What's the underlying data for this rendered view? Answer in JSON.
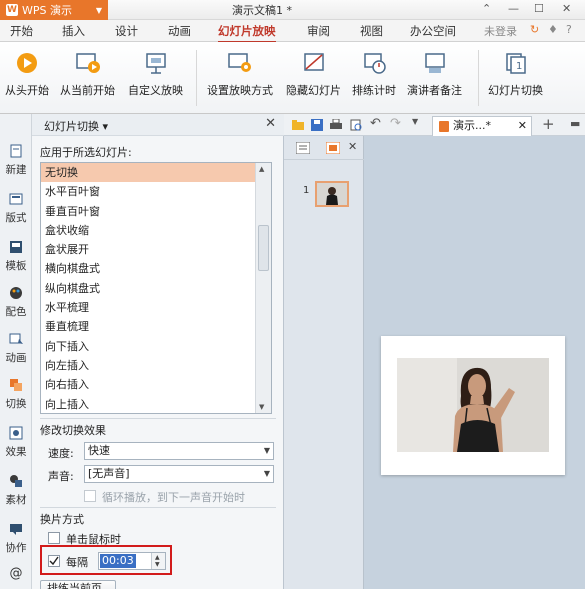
{
  "app": {
    "name": "WPS 演示",
    "document_title": "演示文稿1 *"
  },
  "menu": {
    "items": [
      "开始",
      "插入",
      "设计",
      "动画",
      "幻灯片放映",
      "审阅",
      "视图",
      "办公空间"
    ],
    "active": "幻灯片放映",
    "login": "未登录"
  },
  "toolbar": {
    "buttons": [
      {
        "label": "从头开始",
        "icon": "play-circle-icon"
      },
      {
        "label": "从当前开始",
        "icon": "play-current-icon"
      },
      {
        "label": "自定义放映",
        "icon": "custom-show-icon"
      },
      {
        "label": "设置放映方式",
        "icon": "setup-show-icon"
      },
      {
        "label": "隐藏幻灯片",
        "icon": "hide-slide-icon"
      },
      {
        "label": "排练计时",
        "icon": "rehearse-timing-icon"
      },
      {
        "label": "演讲者备注",
        "icon": "speaker-notes-icon"
      },
      {
        "label": "幻灯片切换",
        "icon": "slide-transition-icon"
      }
    ]
  },
  "sidebar": {
    "items": [
      {
        "label": "新建",
        "icon": "new-doc-icon"
      },
      {
        "label": "版式",
        "icon": "layout-icon"
      },
      {
        "label": "模板",
        "icon": "template-icon"
      },
      {
        "label": "配色",
        "icon": "palette-icon"
      },
      {
        "label": "动画",
        "icon": "animation-icon"
      },
      {
        "label": "切换",
        "icon": "transition-icon"
      },
      {
        "label": "效果",
        "icon": "effect-icon"
      },
      {
        "label": "素材",
        "icon": "material-icon"
      },
      {
        "label": "协作",
        "icon": "collaborate-icon"
      }
    ],
    "active": "切换"
  },
  "pane": {
    "title": "幻灯片切换",
    "apply_label": "应用于所选幻灯片:",
    "transitions": [
      "无切换",
      "水平百叶窗",
      "垂直百叶窗",
      "盒状收缩",
      "盒状展开",
      "横向棋盘式",
      "纵向棋盘式",
      "水平梳理",
      "垂直梳理",
      "向下插入",
      "向左插入",
      "向右插入",
      "向上插入"
    ],
    "selected_transition": "无切换",
    "modify_label": "修改切换效果",
    "speed_label": "速度:",
    "speed_value": "快速",
    "sound_label": "声音:",
    "sound_value": "[无声音]",
    "loop_label": "循环播放，到下一声音开始时",
    "advance_label": "换片方式",
    "on_click_label": "单击鼠标时",
    "every_label": "每隔",
    "every_value": "00:03",
    "apply_button": "排练当前页"
  },
  "doc_tab": {
    "label": "演示...*"
  },
  "thumbnails": {
    "slide_number": "1"
  },
  "colors": {
    "accent": "#e8762a",
    "active_menu": "#c0392b",
    "selection": "#f6c9ae",
    "highlight": "#d21b1b"
  }
}
